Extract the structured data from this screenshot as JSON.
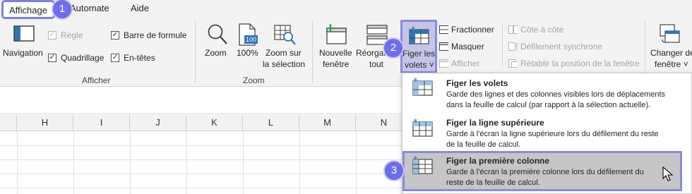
{
  "tabs": {
    "view": "Affichage",
    "automate": "Automate",
    "help": "Aide"
  },
  "afficher": {
    "navigation": "Navigation",
    "regle": "Règle",
    "barre_formule": "Barre de formule",
    "quadrillage": "Quadrillage",
    "en_tetes": "En-têtes",
    "group": "Afficher"
  },
  "zoom": {
    "zoom": "Zoom",
    "pct": "100%",
    "zoom_sel_1": "Zoom sur",
    "zoom_sel_2": "la sélection",
    "group": "Zoom",
    "icon_text": "100"
  },
  "fenetre": {
    "nouvelle_1": "Nouvelle",
    "nouvelle_2": "fenêtre",
    "reorg_1": "Réorgan",
    "reorg_2": "tout",
    "figer_1": "Figer les",
    "figer_2": "volets ˅",
    "fractionner": "Fractionner",
    "masquer": "Masquer",
    "afficher": "Afficher",
    "cote": "Côte à côte",
    "defilement": "Défilement synchrone",
    "retablir": "Rétablir la position de la fenêtre",
    "changer_1": "Changer de",
    "changer_2": "fenêtre ˅"
  },
  "badges": [
    "1",
    "2",
    "3"
  ],
  "columns": [
    "H",
    "I",
    "J",
    "K",
    "L",
    "M",
    "N"
  ],
  "menu": [
    {
      "title": "Figer les volets",
      "desc1": "Garde des lignes et des colonnes visibles lors de déplacements",
      "desc2": "dans la feuille de calcul (par rapport à la sélection actuelle)."
    },
    {
      "title": "Figer la ligne supérieure",
      "desc1": "Garde à l'écran la ligne supérieure lors du défilement du reste",
      "desc2": "de la feuille de calcul."
    },
    {
      "title": "Figer la première colonne",
      "desc1": "Garde à l'écran la première colonne lors du défilement du",
      "desc2": "reste de la feuille de calcul."
    }
  ],
  "colors": {
    "accent": "#6e6ee8",
    "highlight_border": "#8b8bdd",
    "icon_blue": "#2f75b5"
  }
}
